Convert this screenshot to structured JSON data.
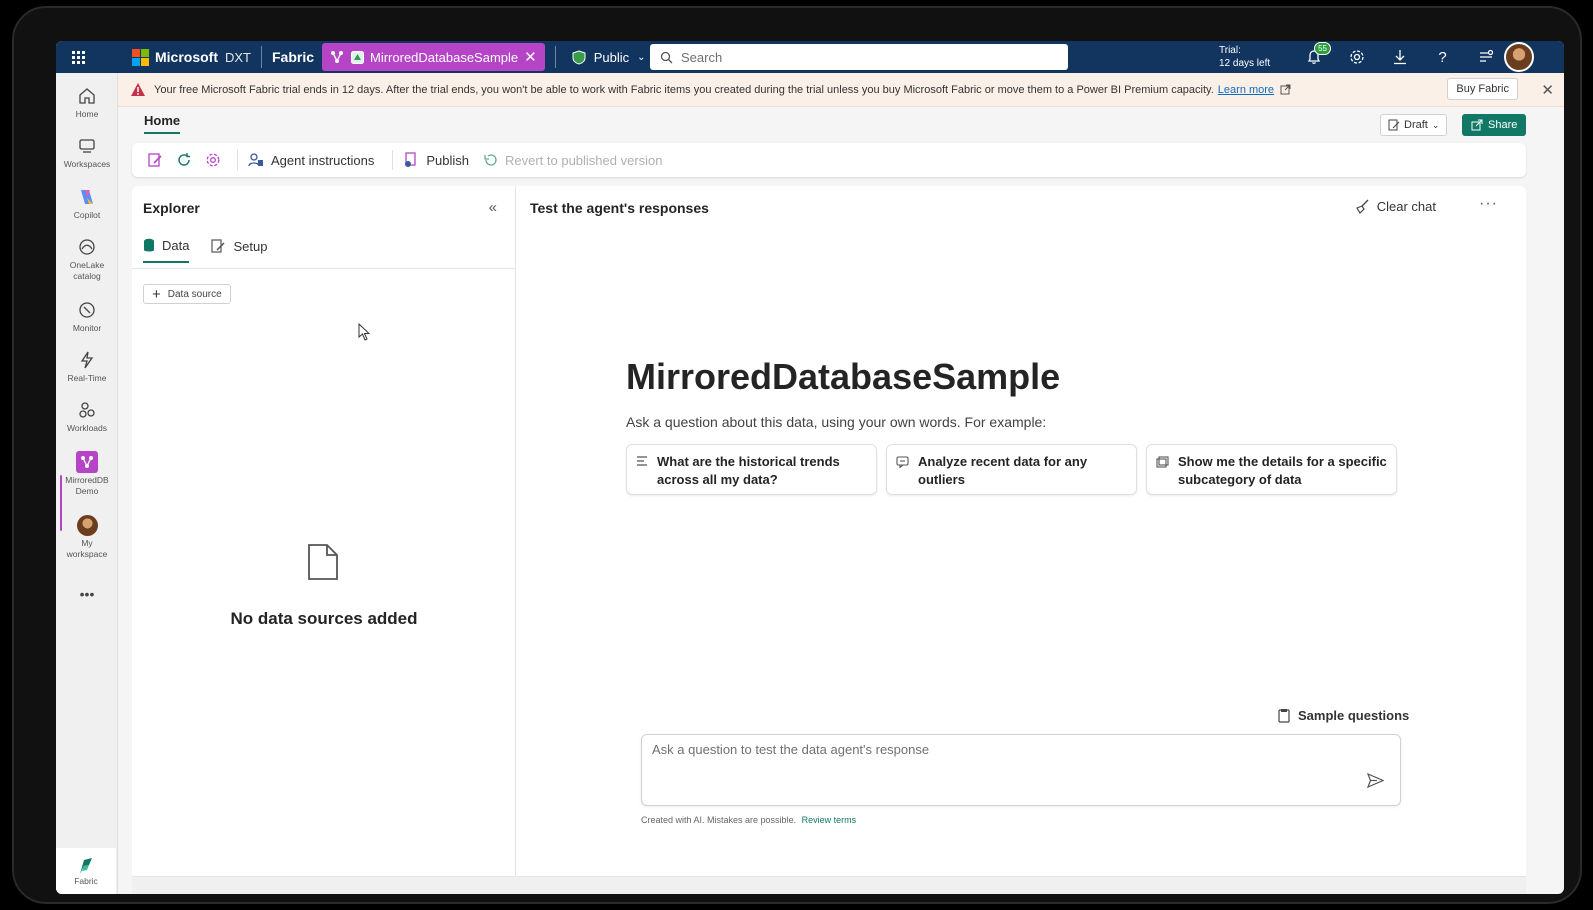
{
  "topbar": {
    "brand": "Microsoft",
    "brand_sub": "DXT",
    "workload": "Fabric",
    "item_tab": "MirroredDatabaseSample",
    "visibility": "Public",
    "search_placeholder": "Search",
    "trial_line1": "Trial:",
    "trial_line2": "12 days left",
    "notification_count": "55",
    "colors": {
      "bar": "#123560",
      "item_tab": "#b544c7"
    }
  },
  "rail": {
    "items": [
      {
        "label": "Home",
        "icon": "home-icon"
      },
      {
        "label": "Workspaces",
        "icon": "workspaces-icon"
      },
      {
        "label": "Copilot",
        "icon": "copilot-icon"
      },
      {
        "label": "OneLake catalog",
        "icon": "onelake-icon"
      },
      {
        "label": "Monitor",
        "icon": "monitor-icon"
      },
      {
        "label": "Real-Time",
        "icon": "lightning-icon"
      },
      {
        "label": "Workloads",
        "icon": "workloads-icon"
      },
      {
        "label": "MirroredDB Demo",
        "icon": "mirroreddb-icon"
      },
      {
        "label": "My workspace",
        "icon": "avatar-icon"
      }
    ],
    "more": "•••",
    "bottom_label": "Fabric"
  },
  "banner": {
    "message": "Your free Microsoft Fabric trial ends in 12 days. After the trial ends, you won't be able to work with Fabric items you created during the trial unless you buy Microsoft Fabric or move them to a Power BI Premium capacity.",
    "learn_more": "Learn more",
    "buy_button": "Buy Fabric"
  },
  "ribbon": {
    "home_tab": "Home",
    "draft": "Draft",
    "share": "Share",
    "agent_instructions": "Agent instructions",
    "publish": "Publish",
    "revert": "Revert to published version"
  },
  "explorer": {
    "title": "Explorer",
    "tabs": [
      "Data",
      "Setup"
    ],
    "data_source_button": "Data source",
    "empty_message": "No data sources added"
  },
  "chat": {
    "title": "Test the agent's responses",
    "clear_chat": "Clear chat",
    "agent_name": "MirroredDatabaseSample",
    "subtitle": "Ask a question about this data, using your own words. For example:",
    "suggestions": [
      "What are the historical trends across all my data?",
      "Analyze recent data for any outliers",
      "Show me the details for a specific subcategory of data"
    ],
    "sample_questions": "Sample questions",
    "input_placeholder": "Ask a question to test the data agent's response",
    "disclaimer": "Created with AI. Mistakes are possible.",
    "review_terms": "Review terms",
    "accent": "#117865"
  }
}
